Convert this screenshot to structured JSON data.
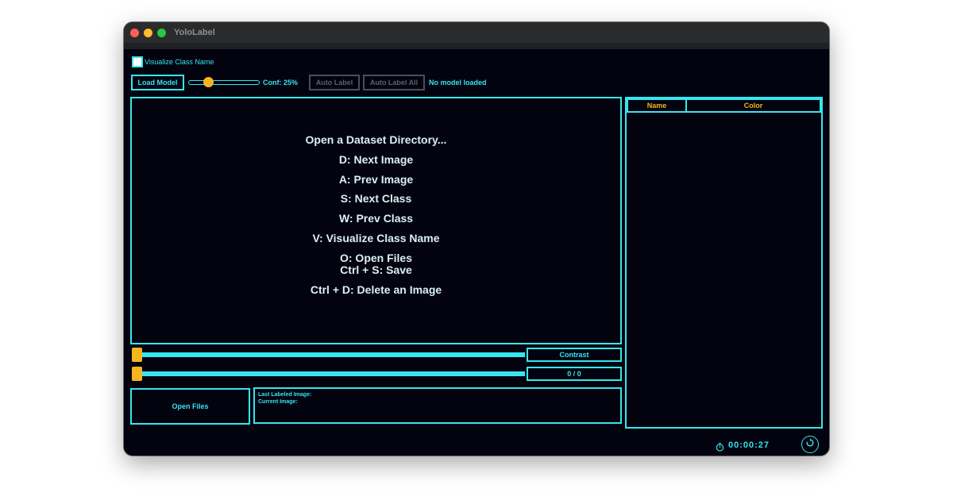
{
  "window": {
    "title": "YoloLabel"
  },
  "toolbar": {
    "visualize_checkbox_label": "Visualize Class Name",
    "load_model_label": "Load Model",
    "confidence_label": "Conf: 25%",
    "confidence_value": 0.25,
    "auto_label_label": "Auto Label",
    "auto_label_all_label": "Auto Label All",
    "model_status": "No model loaded"
  },
  "canvas": {
    "help_lines": [
      "Open a Dataset Directory...",
      "D: Next Image",
      "A: Prev Image",
      "S: Next Class",
      "W: Prev Class",
      "V: Visualize Class Name",
      "O: Open Files",
      "Ctrl + S: Save",
      "Ctrl + D: Delete an Image"
    ]
  },
  "controls": {
    "contrast_label": "Contrast",
    "image_counter": "0 / 0",
    "open_files_label": "Open Files",
    "last_labeled_label": "Last Labeled Image:",
    "current_image_label": "Current Image:"
  },
  "class_table": {
    "headers": [
      "Name",
      "Color"
    ]
  },
  "footer": {
    "timer": "00:00:27"
  },
  "colors": {
    "accent": "#35e6f0",
    "highlight": "#f6b51e",
    "background": "#03030f"
  }
}
